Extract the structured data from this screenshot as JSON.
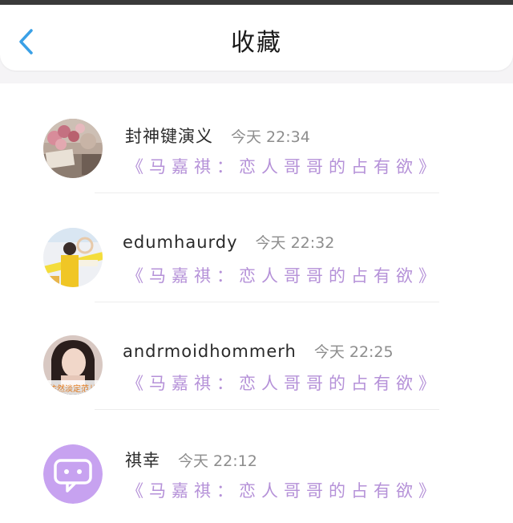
{
  "header": {
    "title": "收藏",
    "back_icon": "chevron-left-icon",
    "accent_color": "#3aa0e6"
  },
  "favorites": [
    {
      "username": "封神键演义",
      "time": "今天 22:34",
      "content": "《马嘉祺：恋人哥哥的占有欲》",
      "avatar": "roses-photo"
    },
    {
      "username": "edumhaurdy",
      "time": "今天 22:32",
      "content": "《马嘉祺：恋人哥哥的占有欲》",
      "avatar": "yellow-outfit-photo"
    },
    {
      "username": "andrmoidhommerh",
      "time": "今天 22:25",
      "content": "《马嘉祺：恋人哥哥的占有欲》",
      "avatar": "girl-portrait-photo",
      "avatar_caption": "依然淡定范儿"
    },
    {
      "username": "祺幸",
      "time": "今天 22:12",
      "content": "《马嘉祺：恋人哥哥的占有欲》",
      "avatar": "chat-bubble-icon"
    }
  ],
  "colors": {
    "link": "#b591d8",
    "time": "#8d8d8d",
    "avatar_purple": "#c7a2f0"
  }
}
